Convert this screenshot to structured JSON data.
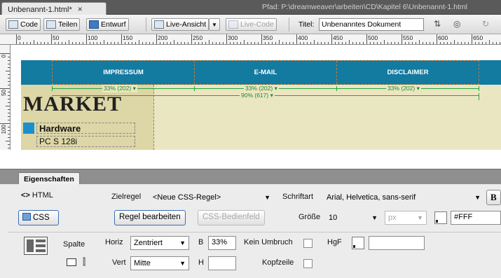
{
  "document": {
    "tab_label": "Unbenannt-1.html*",
    "tab_close": "×",
    "path_text": "Pfad:  P:\\dreamweaver\\arbeiten\\CD\\Kapitel 6\\Unbenannt-1.html"
  },
  "toolbar": {
    "code_label": "Code",
    "split_label": "Teilen",
    "design_label": "Entwurf",
    "live_view_label": "Live-Ansicht",
    "live_code_label": "Live-Code",
    "title_label": "Titel:",
    "title_value": "Unbenanntes Dokument"
  },
  "ruler": {
    "labels": [
      "0",
      "50",
      "100",
      "150",
      "200",
      "250",
      "300",
      "350",
      "400",
      "450",
      "500",
      "550",
      "600",
      "650"
    ],
    "vlabels": [
      "0",
      "50",
      "100"
    ]
  },
  "canvas": {
    "nav_items": [
      "IMPRESSUM",
      "E-MAIL",
      "DISCLAIMER"
    ],
    "col_width_labels": [
      "33% (202) ▾",
      "33% (202) ▾",
      "33% (202) ▾"
    ],
    "table_width_label": "90% (617) ▾",
    "logo_text": "MARKET",
    "sidebar_heading": "Hardware",
    "sidebar_item": "PC S 128i",
    "colors": {
      "nav_blue": "#137aa0",
      "beige": "#ebe6c2",
      "guide_green": "#2aa23a",
      "hardware_square": "#1a8fd0"
    }
  },
  "properties": {
    "tab_label": "Eigenschaften",
    "html_label": "HTML",
    "css_label": "CSS",
    "target_rule_label": "Zielregel",
    "target_rule_value": "<Neue CSS-Regel>",
    "edit_rule_button": "Regel bearbeiten",
    "css_panel_button": "CSS-Bedienfeld",
    "font_label": "Schriftart",
    "font_value": "Arial, Helvetica, sans-serif",
    "bold_label": "B",
    "size_label": "Größe",
    "size_value": "10",
    "unit_value": "px",
    "color_value": "#FFF",
    "column_label": "Spalte",
    "horiz_label": "Horiz",
    "horiz_value": "Zentriert",
    "vert_label": "Vert",
    "vert_value": "Mitte",
    "width_label": "B",
    "width_value": "33%",
    "height_label": "H",
    "height_value": "",
    "nowrap_label": "Kein Umbruch",
    "header_label": "Kopfzeile",
    "bg_label": "HgF",
    "bg_value": ""
  }
}
